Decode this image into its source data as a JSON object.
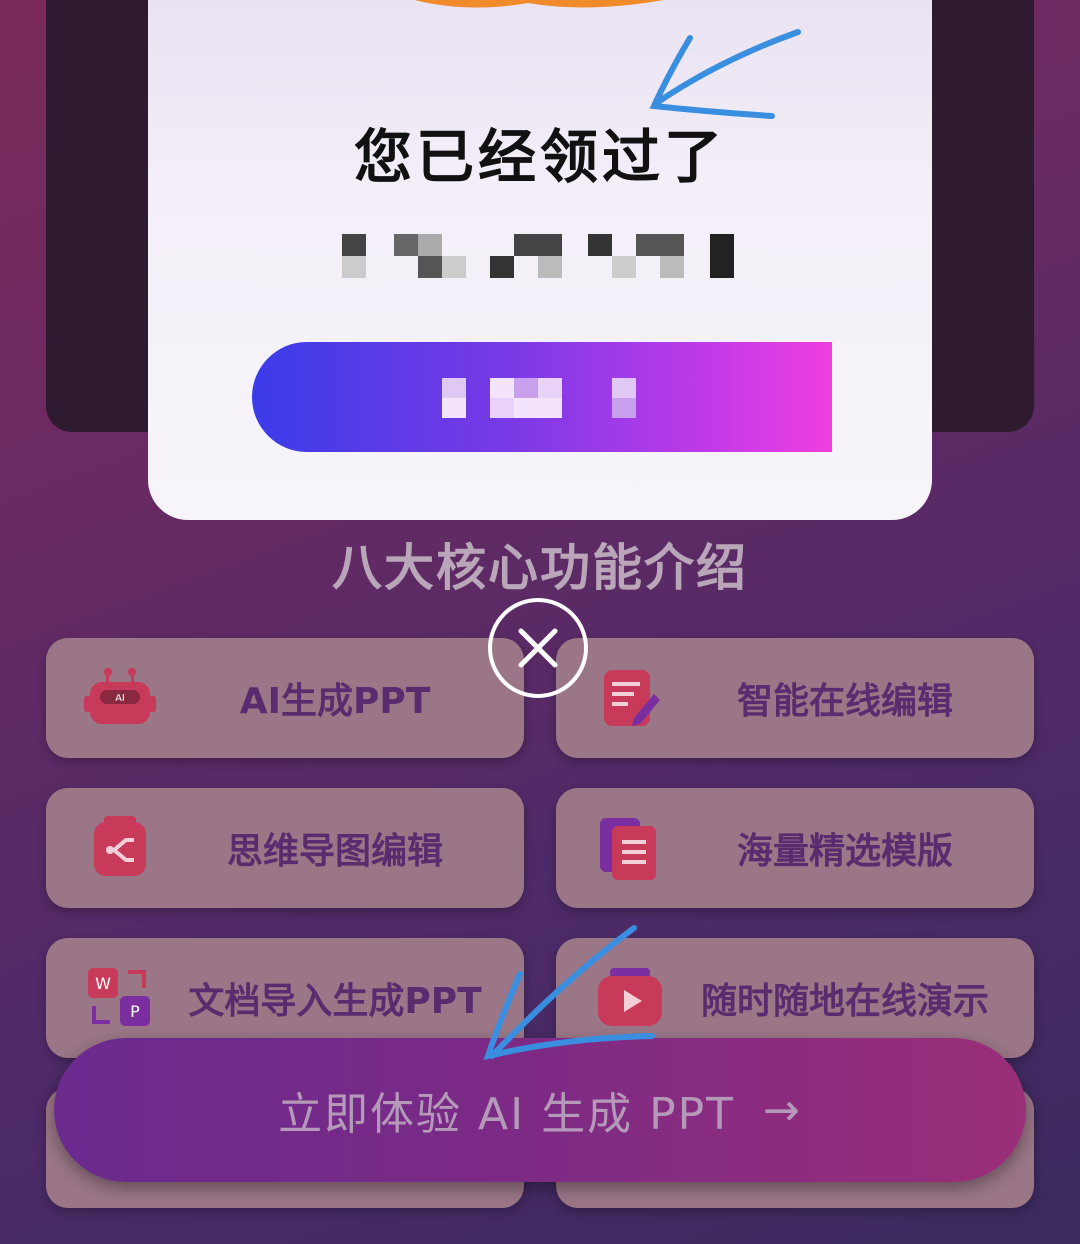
{
  "modal": {
    "title": "您已经领过了"
  },
  "section": {
    "title": "八大核心功能介绍"
  },
  "features": [
    {
      "label": "AI生成PPT",
      "icon": "robot-ai-icon"
    },
    {
      "label": "智能在线编辑",
      "icon": "edit-document-icon"
    },
    {
      "label": "思维导图编辑",
      "icon": "mindmap-icon"
    },
    {
      "label": "海量精选模版",
      "icon": "templates-icon"
    },
    {
      "label": "文档导入生成PPT",
      "icon": "word-to-ppt-icon"
    },
    {
      "label": "随时随地在线演示",
      "icon": "play-presentation-icon"
    }
  ],
  "cta": {
    "label": "立即体验 AI 生成 PPT",
    "arrow": "→"
  },
  "colors": {
    "accent_gradient_start": "#3a3ce8",
    "accent_gradient_end": "#f03ee0",
    "card_bg": "#9a7686",
    "card_text": "#5a2b6e",
    "annotation_blue": "#3a8ee0"
  }
}
